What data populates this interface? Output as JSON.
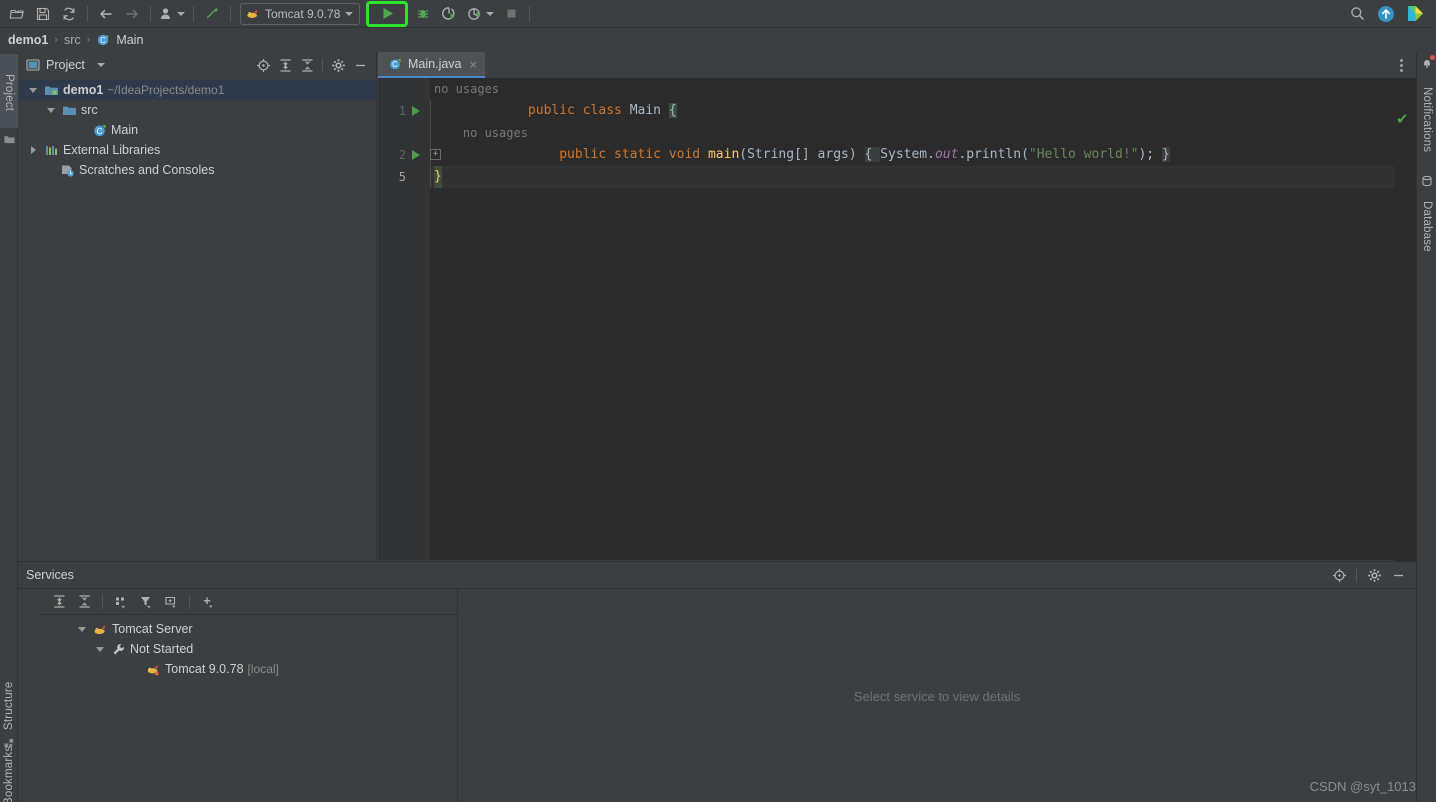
{
  "toolbar": {
    "buttons": [
      {
        "name": "open-folder-icon",
        "label": "Open"
      },
      {
        "name": "save-icon",
        "label": "Save All"
      },
      {
        "name": "sync-icon",
        "label": "Reload from Disk"
      },
      {
        "name": "back-arrow-icon",
        "label": "Back"
      },
      {
        "name": "forward-arrow-icon",
        "label": "Forward"
      },
      {
        "name": "profile-icon",
        "label": "Profile"
      },
      {
        "name": "build-hammer-icon",
        "label": "Build Project"
      }
    ],
    "run_config": {
      "label": "Tomcat 9.0.78",
      "icon": "tomcat-icon"
    },
    "run_button_label": "Run",
    "debug_button_label": "Debug",
    "run_coverage_label": "Run with Coverage",
    "profile_label": "Profiler",
    "stop_label": "Stop",
    "highlight_color": "#2ee32e",
    "right_icons": [
      {
        "name": "search-icon",
        "label": "Search Everywhere"
      },
      {
        "name": "update-icon",
        "label": "IDE Update"
      },
      {
        "name": "ide-logo-icon",
        "label": "IntelliJ IDEA"
      }
    ]
  },
  "breadcrumb": {
    "project": "demo1",
    "separator": "›",
    "folder": "src",
    "file": "Main",
    "file_icon": "java-class-icon"
  },
  "left_strip": {
    "project_tab": "Project",
    "structure_tab": "Structure",
    "bookmarks_tab": "Bookmarks"
  },
  "right_strip": {
    "notifications_tab": "Notifications",
    "database_tab": "Database"
  },
  "project_panel": {
    "title": "Project",
    "icons": [
      {
        "name": "locate-icon",
        "label": "Select Opened File"
      },
      {
        "name": "expand-all-icon",
        "label": "Expand All"
      },
      {
        "name": "collapse-all-icon",
        "label": "Collapse All"
      },
      {
        "name": "gear-icon",
        "label": "Options"
      },
      {
        "name": "minimize-icon",
        "label": "Hide"
      }
    ],
    "tree": [
      {
        "label": "demo1",
        "path": "~/IdeaProjects/demo1",
        "icon": "module-icon",
        "indent": 0,
        "chevron": "down",
        "selected": true,
        "bold": true
      },
      {
        "label": "src",
        "path": "",
        "icon": "folder-icon",
        "indent": 1,
        "chevron": "down",
        "selected": false,
        "bold": false
      },
      {
        "label": "Main",
        "path": "",
        "icon": "java-class-icon",
        "indent": 2,
        "chevron": "none",
        "selected": false,
        "bold": false
      },
      {
        "label": "External Libraries",
        "path": "",
        "icon": "libraries-icon",
        "indent": 0,
        "chevron": "right",
        "selected": false,
        "bold": false
      },
      {
        "label": "Scratches and Consoles",
        "path": "",
        "icon": "scratches-icon",
        "indent": 0,
        "chevron": "none",
        "selected": false,
        "bold": false
      }
    ]
  },
  "editor": {
    "tab": {
      "label": "Main.java",
      "icon": "java-class-icon",
      "close": "×"
    },
    "more_label": "More Options",
    "inspection_status": "✔",
    "lines": [
      {
        "num": "",
        "run_marker": false,
        "fold": false,
        "current": false,
        "tokens": [
          {
            "t": "no usages",
            "c": "k-hint",
            "indent": 0
          }
        ]
      },
      {
        "num": "1",
        "run_marker": true,
        "fold": false,
        "current": false,
        "tokens": [
          {
            "t": "public ",
            "c": "k-kw"
          },
          {
            "t": "class ",
            "c": "k-kw"
          },
          {
            "t": "Main ",
            "c": "k-txt"
          },
          {
            "t": "{",
            "c": "k-brace-hl"
          }
        ]
      },
      {
        "num": "",
        "run_marker": false,
        "fold": false,
        "current": false,
        "tokens": [
          {
            "t": "    no usages",
            "c": "k-hint"
          }
        ]
      },
      {
        "num": "2",
        "run_marker": true,
        "fold": true,
        "current": false,
        "tokens": [
          {
            "t": "    ",
            "c": "k-txt"
          },
          {
            "t": "public ",
            "c": "k-kw"
          },
          {
            "t": "static ",
            "c": "k-kw"
          },
          {
            "t": "void ",
            "c": "k-kw"
          },
          {
            "t": "main",
            "c": "k-fn"
          },
          {
            "t": "(String[] args) ",
            "c": "k-txt"
          },
          {
            "t": "{ ",
            "c": "k-grayblock"
          },
          {
            "t": "System.",
            "c": "k-txt"
          },
          {
            "t": "out",
            "c": "k-field"
          },
          {
            "t": ".println(",
            "c": "k-txt"
          },
          {
            "t": "\"Hello world!\"",
            "c": "k-str"
          },
          {
            "t": "); ",
            "c": "k-txt"
          },
          {
            "t": "}",
            "c": "k-grayblock"
          }
        ]
      },
      {
        "num": "5",
        "run_marker": false,
        "fold": false,
        "current": true,
        "tokens": [
          {
            "t": "}",
            "c": "k-brace-y"
          }
        ]
      }
    ]
  },
  "services": {
    "title": "Services",
    "header_icons": [
      {
        "name": "locate-icon",
        "label": "Locate"
      },
      {
        "name": "gear-icon",
        "label": "Settings"
      },
      {
        "name": "minimize-icon",
        "label": "Hide"
      }
    ],
    "toolbar_icons": [
      {
        "name": "expand-all-icon",
        "label": "Expand All"
      },
      {
        "name": "collapse-all-icon",
        "label": "Collapse All"
      },
      {
        "name": "group-icon",
        "label": "Group"
      },
      {
        "name": "filter-icon",
        "label": "Filter"
      },
      {
        "name": "add-to-view-icon",
        "label": "Add Service View"
      },
      {
        "name": "plus-icon",
        "label": "Add Service"
      }
    ],
    "tree": [
      {
        "label": "Tomcat Server",
        "suffix": "",
        "icon": "tomcat-icon",
        "indent": 0,
        "chevron": "down"
      },
      {
        "label": "Not Started",
        "suffix": "",
        "icon": "wrench-icon",
        "indent": 1,
        "chevron": "down"
      },
      {
        "label": "Tomcat 9.0.78",
        "suffix": "[local]",
        "icon": "tomcat-stopped-icon",
        "indent": 2,
        "chevron": "none"
      }
    ],
    "empty_message": "Select service to view details"
  },
  "watermark": "CSDN @syt_1013"
}
